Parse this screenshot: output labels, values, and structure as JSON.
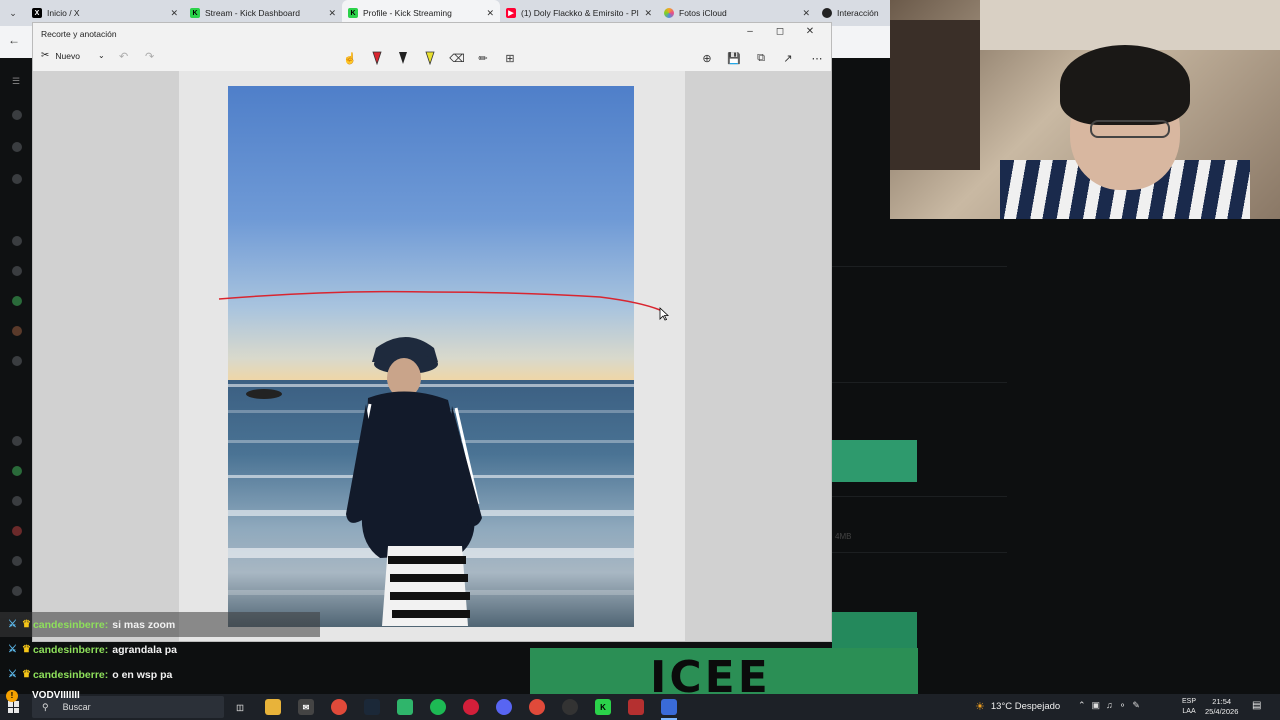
{
  "browser": {
    "tabs": [
      {
        "title": "Inicio / X",
        "favicon": "x-logo-icon",
        "color": "#000000"
      },
      {
        "title": "Stream - Kick Dashboard",
        "favicon": "kick-logo-icon",
        "color": "#2bd24a"
      },
      {
        "title": "Profile - Kick Streaming",
        "favicon": "kick-logo-icon",
        "color": "#2bd24a",
        "active": true
      },
      {
        "title": "(1) Doly Flackko & Emirsito - Pl",
        "favicon": "youtube-icon",
        "color": "#ff0033"
      },
      {
        "title": "Fotos iCloud",
        "favicon": "icloud-photos-icon",
        "color": "#f5a623"
      },
      {
        "title": "Interacción | E",
        "favicon": "github-icon",
        "color": "#222222"
      }
    ]
  },
  "snip": {
    "title": "Recorte y anotación",
    "new_label": "Nuevo",
    "tools": [
      "touch-writing-icon",
      "ballpoint-pen-icon",
      "pencil-icon",
      "highlighter-icon",
      "eraser-icon",
      "ruler-icon",
      "crop-icon"
    ],
    "actions": [
      "zoom-icon",
      "save-icon",
      "copy-icon",
      "share-icon",
      "more-icon"
    ],
    "pen_color": "#d9252f"
  },
  "chat": {
    "messages": [
      {
        "user": "candesinberre:",
        "text": "si mas zoom"
      },
      {
        "user": "candesinberre:",
        "text": "agrandala pa"
      },
      {
        "user": "candesinberre:",
        "text": "o en wsp pa"
      }
    ],
    "vod_text": "VODVIIIIIII"
  },
  "taskbar": {
    "search_placeholder": "Buscar",
    "weather": "13°C  Despejado",
    "lang_line1": "ESP",
    "lang_line2": "LAA",
    "time": "21:54",
    "date": "25/4/2026"
  },
  "page": {
    "faint_size": "4MB",
    "banner_text": "ICEE"
  }
}
